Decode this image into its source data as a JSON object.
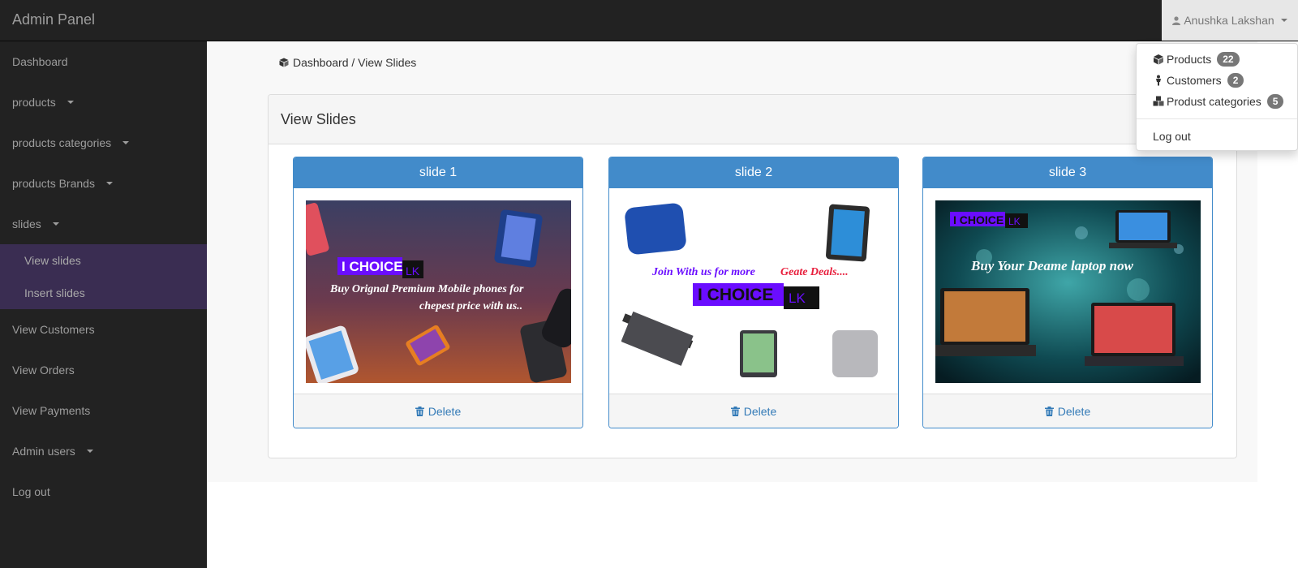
{
  "navbar": {
    "brand": "Admin Panel",
    "user_name": "Anushka Lakshan"
  },
  "sidebar": {
    "items": [
      {
        "label": "Dashboard"
      },
      {
        "label": "products"
      },
      {
        "label": "products categories"
      },
      {
        "label": "products Brands"
      },
      {
        "label": "slides"
      },
      {
        "label": "View Customers"
      },
      {
        "label": "View Orders"
      },
      {
        "label": "View Payments"
      },
      {
        "label": "Admin users"
      },
      {
        "label": "Log out"
      }
    ],
    "slides_submenu": [
      {
        "label": "View slides"
      },
      {
        "label": "Insert slides"
      }
    ]
  },
  "breadcrumb": {
    "text": "Dashboard / View Slides"
  },
  "panel": {
    "title": "View Slides"
  },
  "slides": [
    {
      "title": "slide 1",
      "delete_label": "Delete",
      "logo_main": "I CHOICE",
      "logo_suffix": "LK",
      "caption_1": "Buy Orignal Premium Mobile phones for",
      "caption_2": "chepest price with us.."
    },
    {
      "title": "slide 2",
      "delete_label": "Delete",
      "caption_a": "Join With us for more ",
      "caption_b": "Geate Deals....",
      "logo_main": "I CHOICE",
      "logo_suffix": "LK"
    },
    {
      "title": "slide 3",
      "delete_label": "Delete",
      "logo_main": "I CHOICE",
      "logo_suffix": "LK",
      "caption": "Buy Your Deame laptop now"
    }
  ],
  "dropdown": {
    "items": [
      {
        "label": "Products",
        "badge": "22",
        "icon": "cube-icon"
      },
      {
        "label": "Customers",
        "badge": "2",
        "icon": "person-icon"
      },
      {
        "label": "Produst categories",
        "badge": "5",
        "icon": "cubes-icon"
      }
    ],
    "logout": "Log out"
  },
  "colors": {
    "navbar_bg": "#222222",
    "submenu_bg": "#3a2d52",
    "panel_primary": "#428bca",
    "link": "#337ab7",
    "logo_purple": "#6a0dff"
  }
}
